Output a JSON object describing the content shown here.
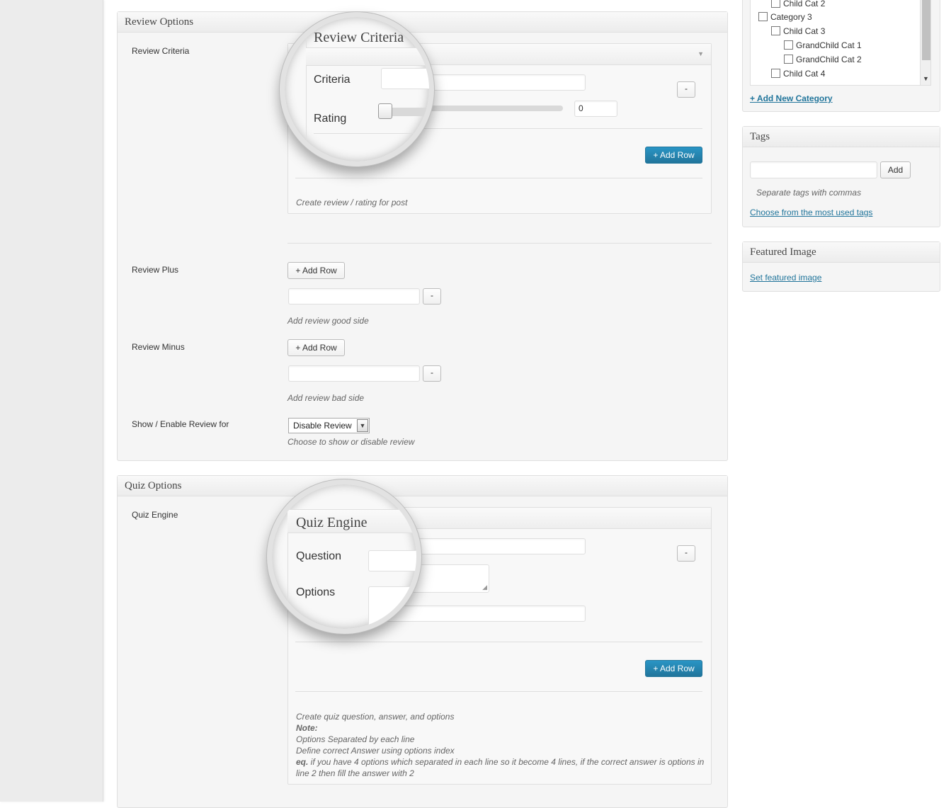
{
  "review_options": {
    "title": "Review Options",
    "review_criteria": {
      "label": "Review Criteria",
      "criteria_label": "Criteria",
      "rating_label": "Rating",
      "rating_value": "0",
      "rating_level": 0,
      "remove_label": "-",
      "add_row_label": "+ Add Row",
      "description": "Create review / rating for post"
    },
    "review_plus": {
      "label": "Review Plus",
      "add_row_label": "+ Add Row",
      "remove_label": "-",
      "description": "Add review good side"
    },
    "review_minus": {
      "label": "Review Minus",
      "add_row_label": "+ Add Row",
      "remove_label": "-",
      "description": "Add review bad side"
    },
    "show_enable": {
      "label": "Show / Enable Review for",
      "selected": "Disable Review",
      "description": "Choose to show or disable review"
    }
  },
  "quiz_options": {
    "title": "Quiz Options",
    "quiz_engine": {
      "label": "Quiz Engine",
      "question_label": "Question",
      "options_label": "Options",
      "remove_label": "-",
      "add_row_label": "+ Add Row",
      "description_line1": "Create quiz question, answer, and options",
      "note_label": "Note:",
      "note_line1": "Options Separated by each line",
      "note_line2": "Define correct Answer using options index",
      "eq_label": "eq.",
      "eq_text": " if you have 4 options which separated in each line so it become 4 lines, if the correct answer is options in line 2 then fill the answer with 2"
    }
  },
  "magnifier_review": {
    "title": "Review Criteria",
    "criteria_label": "Criteria",
    "rating_label": "Rating"
  },
  "magnifier_quiz": {
    "title": "Quiz Engine",
    "question_label": "Question",
    "options_label": "Options"
  },
  "categories": {
    "items": [
      {
        "label": "Child Cat 2",
        "level": 1
      },
      {
        "label": "Category 3",
        "level": 0
      },
      {
        "label": "Child Cat 3",
        "level": 1
      },
      {
        "label": "GrandChild Cat 1",
        "level": 2
      },
      {
        "label": "GrandChild Cat 2",
        "level": 2
      },
      {
        "label": "Child Cat 4",
        "level": 1
      }
    ],
    "add_new_label": "+ Add New Category"
  },
  "tags": {
    "title": "Tags",
    "add_label": "Add",
    "hint": "Separate tags with commas",
    "choose_link": "Choose from the most used tags"
  },
  "featured_image": {
    "title": "Featured Image",
    "set_link": "Set featured image"
  },
  "colors": {
    "primary_button": "#21759b",
    "link": "#21759b",
    "panel_bg": "#f5f5f5",
    "border": "#dfdfdf"
  }
}
